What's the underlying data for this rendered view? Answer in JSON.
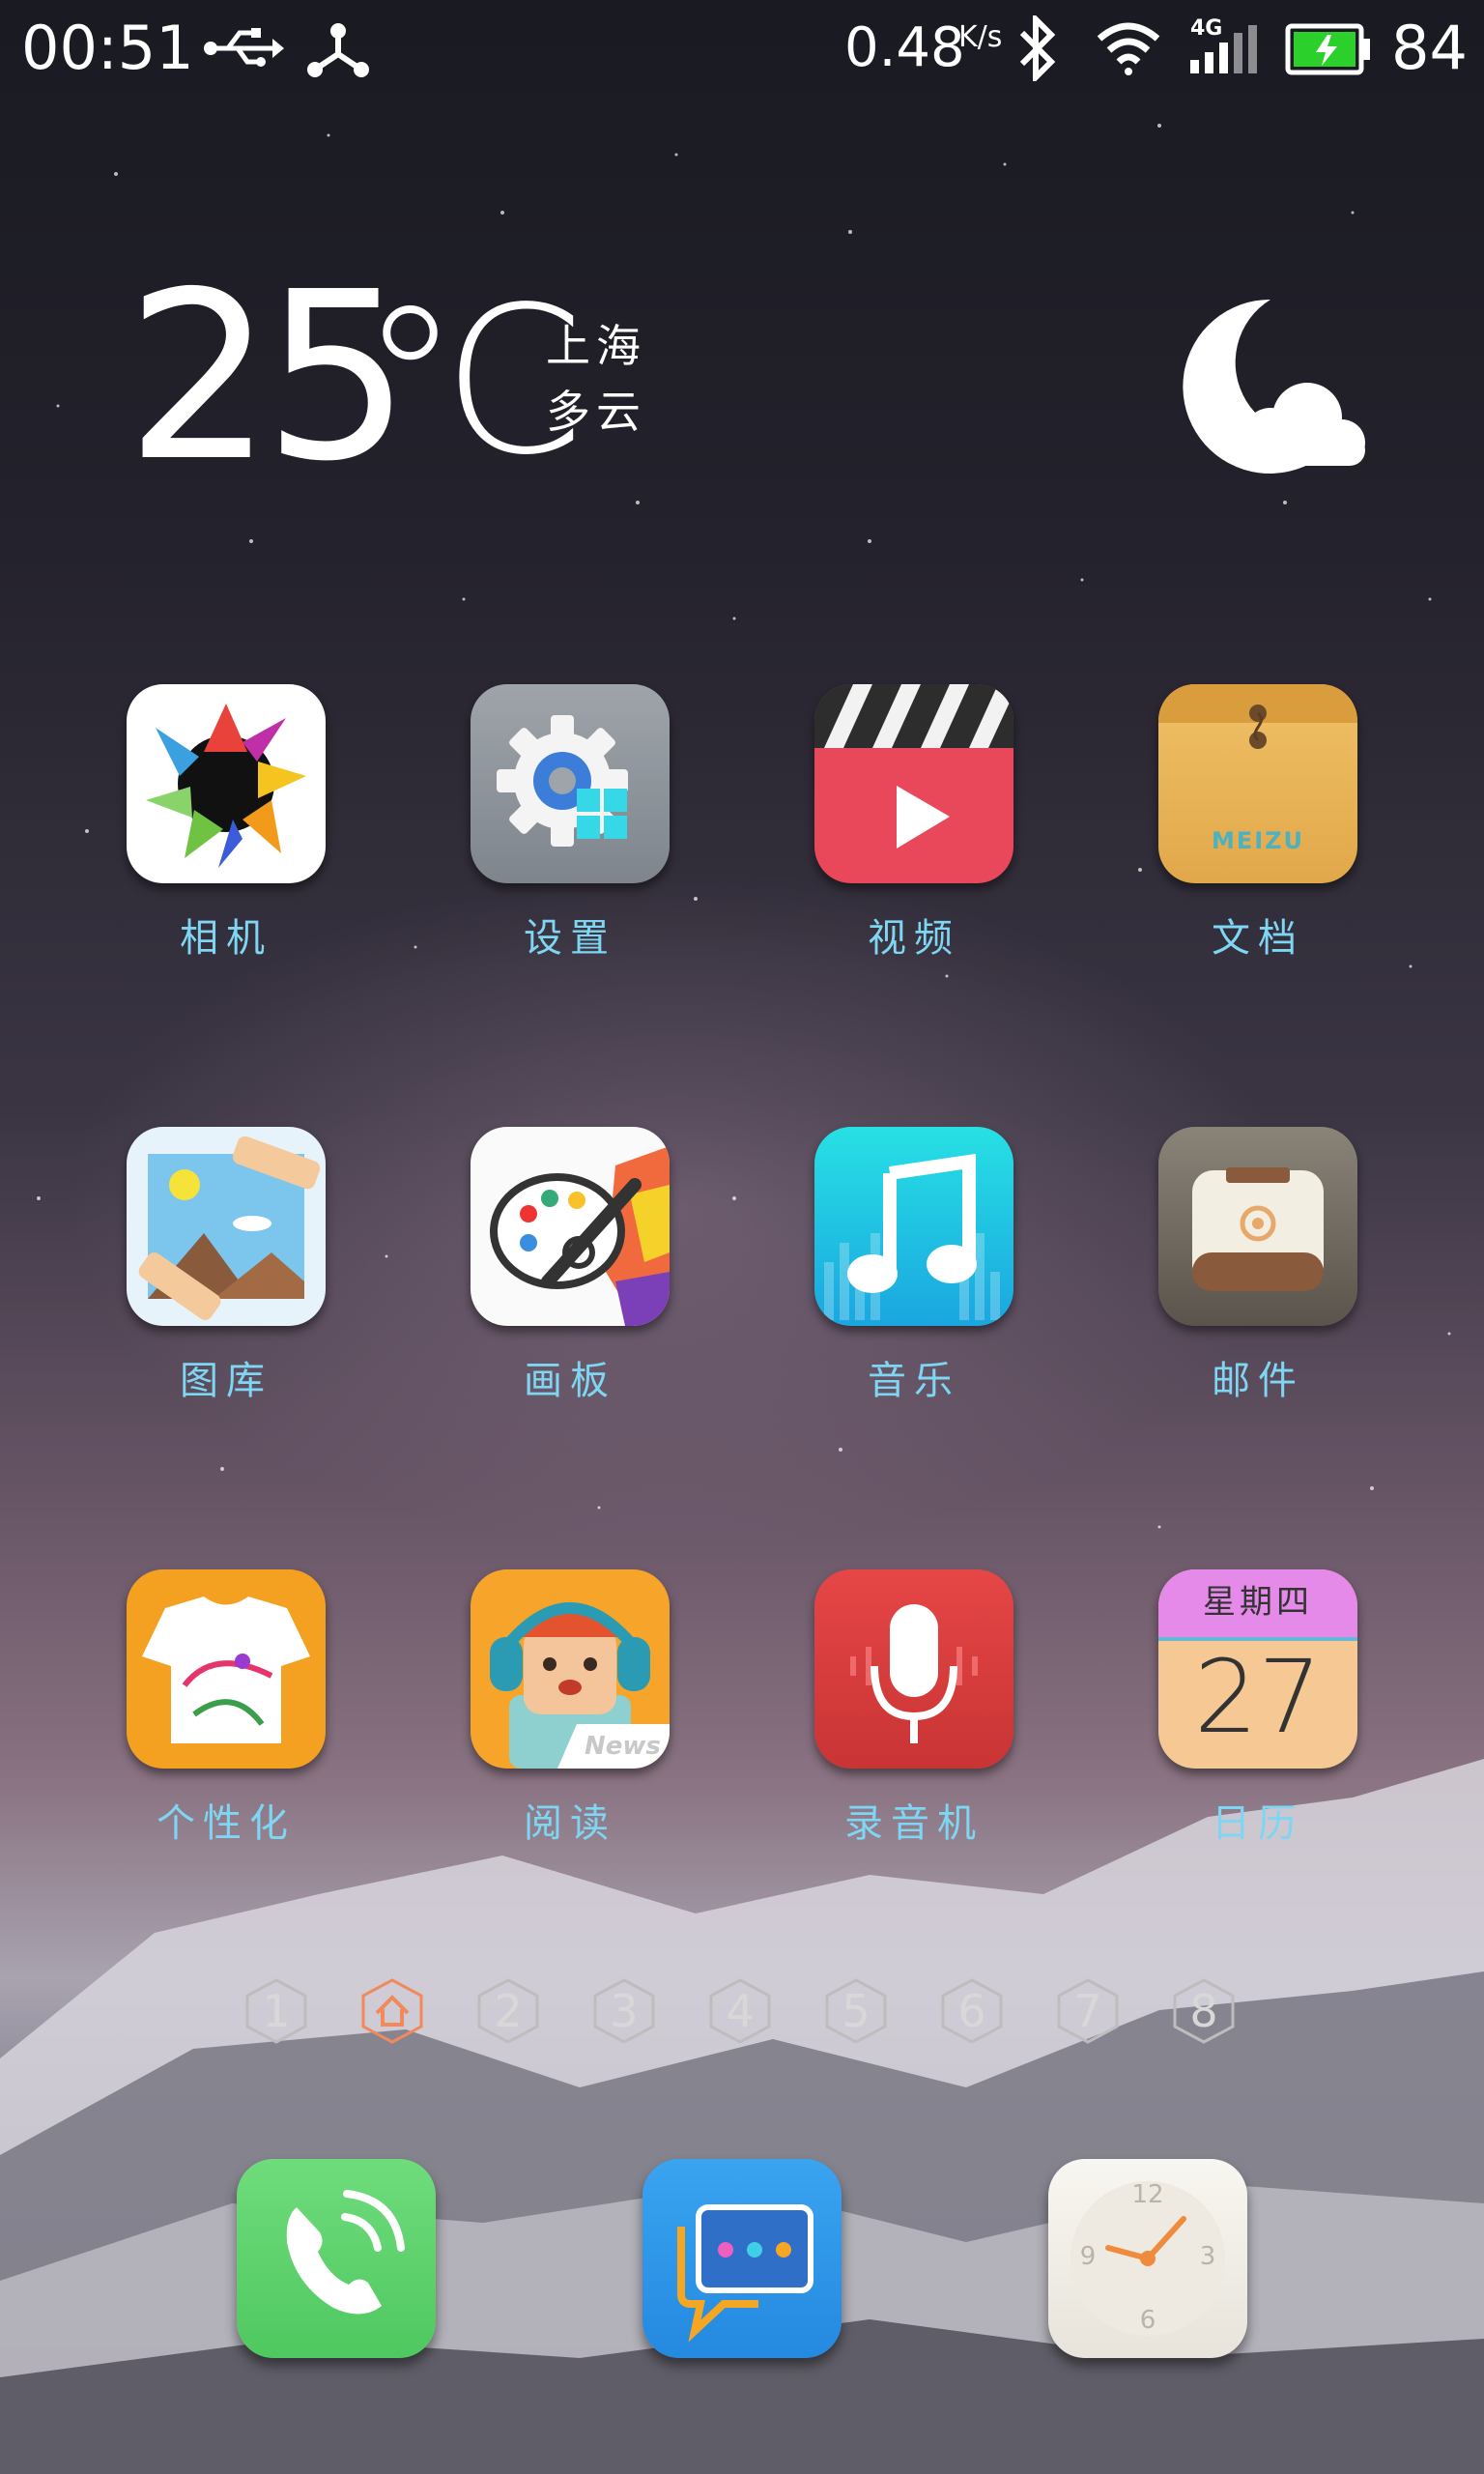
{
  "status_bar": {
    "time": "00:51",
    "net_speed": "0.48",
    "net_speed_unit": "K/s",
    "network_type": "4G",
    "battery_percent": "84",
    "icons": [
      "usb-icon",
      "share-icon",
      "bluetooth-icon",
      "wifi-icon",
      "signal-icon",
      "battery-charging-icon"
    ]
  },
  "weather": {
    "temperature": "25",
    "unit": "℃",
    "city": "上海",
    "condition": "多云",
    "icon": "moon-cloud-icon"
  },
  "apps": [
    {
      "label": "相机",
      "icon": "camera-icon"
    },
    {
      "label": "设置",
      "icon": "settings-icon"
    },
    {
      "label": "视频",
      "icon": "video-icon"
    },
    {
      "label": "文档",
      "icon": "documents-icon"
    },
    {
      "label": "图库",
      "icon": "gallery-icon"
    },
    {
      "label": "画板",
      "icon": "paint-icon"
    },
    {
      "label": "音乐",
      "icon": "music-icon"
    },
    {
      "label": "邮件",
      "icon": "mail-icon"
    },
    {
      "label": "个性化",
      "icon": "theme-icon"
    },
    {
      "label": "阅读",
      "icon": "reader-icon"
    },
    {
      "label": "录音机",
      "icon": "recorder-icon"
    },
    {
      "label": "日历",
      "icon": "calendar-icon"
    }
  ],
  "documents_brand": "MEIZU",
  "reader_badge": "News",
  "calendar": {
    "weekday": "星期四",
    "day": "27"
  },
  "pager": {
    "pages": [
      "1",
      "home",
      "2",
      "3",
      "4",
      "5",
      "6",
      "7",
      "8"
    ],
    "active": "home",
    "active_color": "#f08a5d"
  },
  "dock": [
    {
      "icon": "phone-icon"
    },
    {
      "icon": "messages-icon"
    },
    {
      "icon": "clock-icon",
      "numbers": [
        "12",
        "3",
        "6",
        "9"
      ]
    }
  ]
}
